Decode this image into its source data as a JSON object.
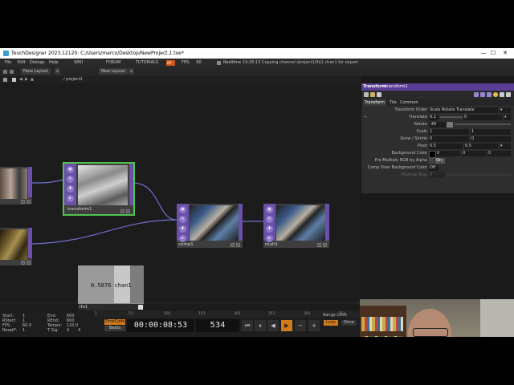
{
  "window": {
    "title": "TouchDesigner 2023.12120: C:/Users/marco/Desktop/NewProject.1.toe*",
    "min": "—",
    "max": "☐",
    "close": "✕"
  },
  "menu": {
    "items": [
      "File",
      "Edit",
      "Dialogs",
      "Help",
      "WIKI",
      "FORUM",
      "TUTORIALS"
    ],
    "perform": "OP",
    "fps_label": "FPS:",
    "fps_value": "60",
    "realtime": "Realtime",
    "status": "19:36:13 Copying channel /project1/lfo1 chan1 for export."
  },
  "panebar": {
    "pane_layout": "Pane Layout",
    "new_layout": "New Layout",
    "plus": "+"
  },
  "path": {
    "text": "/ project1"
  },
  "nodes": {
    "transform": "transform1",
    "comp": "comp1",
    "mult": "mult1",
    "lfo": "lfo1",
    "lfo_value": "0.5876 chan1"
  },
  "params": {
    "type": "Transform",
    "name": "transform1",
    "tabs": [
      "Transform",
      "Tile",
      "Common"
    ],
    "rows": [
      {
        "label": "Transform Order",
        "v1": "Scale Rotate Translate"
      },
      {
        "label": "Translate",
        "v1": "0.1",
        "v2": "0"
      },
      {
        "label": "Rotate",
        "v1": "-48"
      },
      {
        "label": "Scale",
        "v1": "1",
        "v2": "1"
      },
      {
        "label": "Grow / Shrink",
        "v1": "0",
        "v2": "0"
      },
      {
        "label": "Pivot",
        "v1": "0.5",
        "v2": "0.5"
      },
      {
        "label": "Background Color",
        "v1": "0",
        "v2": "0",
        "v3": "0"
      },
      {
        "label": "Pre-Multiply RGB by Alpha",
        "v1": "On"
      },
      {
        "label": "Comp Over Background Color",
        "v1": "Off"
      },
      {
        "label": "Mipmap Bias",
        "v1": "0"
      }
    ],
    "translate_marker": "+"
  },
  "timeline": {
    "ticks": [
      "1",
      "51",
      "101",
      "151",
      "201",
      "251",
      "301",
      "351"
    ],
    "start_label": "Start:",
    "start": "1",
    "rstart_label": "RStart:",
    "rstart": "1",
    "fps_label": "FPS:",
    "fps": "60.0",
    "resetf_label": "ResetF:",
    "resetf": "1",
    "end_label": "End:",
    "end": "600",
    "rend_label": "REnd:",
    "rend": "600",
    "tempo_label": "Tempo:",
    "tempo": "120.0",
    "tsig_label": "T Sig:",
    "tsig1": "4",
    "tsig2": "4",
    "timecode_btn": "TimeCode",
    "beats_btn": "Beats",
    "timecode": "00:00:08:53",
    "frame": "534",
    "range_limit": "Range Limit",
    "loop": "Loop",
    "once": "Once"
  },
  "colors": {
    "accent": "#d17a1c",
    "top_header": "#5b3f96",
    "selected_node": "#4ec44e"
  }
}
